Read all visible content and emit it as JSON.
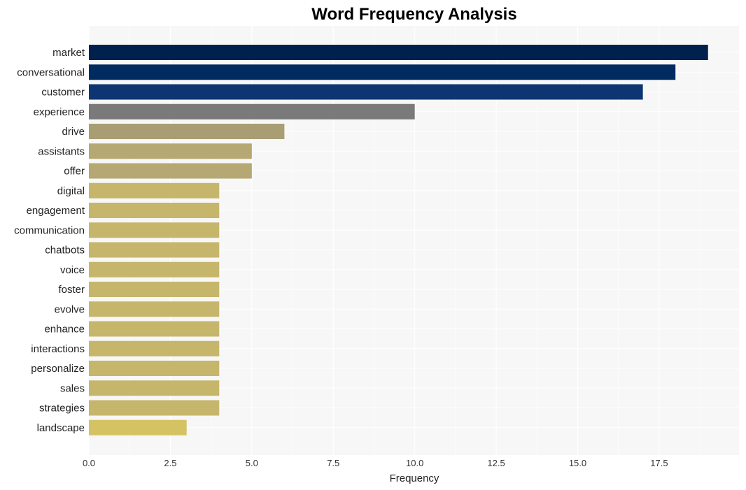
{
  "chart_data": {
    "type": "bar",
    "orientation": "horizontal",
    "title": "Word Frequency Analysis",
    "xlabel": "Frequency",
    "ylabel": "",
    "xlim": [
      0,
      19.95
    ],
    "xticks": [
      0.0,
      2.5,
      5.0,
      7.5,
      10.0,
      12.5,
      15.0,
      17.5
    ],
    "xtick_labels": [
      "0.0",
      "2.5",
      "5.0",
      "7.5",
      "10.0",
      "12.5",
      "15.0",
      "17.5"
    ],
    "grid": true,
    "categories": [
      "market",
      "conversational",
      "customer",
      "experience",
      "drive",
      "assistants",
      "offer",
      "digital",
      "engagement",
      "communication",
      "chatbots",
      "voice",
      "foster",
      "evolve",
      "enhance",
      "interactions",
      "personalize",
      "sales",
      "strategies",
      "landscape"
    ],
    "values": [
      19,
      18,
      17,
      10,
      6,
      5,
      5,
      4,
      4,
      4,
      4,
      4,
      4,
      4,
      4,
      4,
      4,
      4,
      4,
      3
    ],
    "colors": [
      "#00214d",
      "#002b61",
      "#0d3572",
      "#7a7a7a",
      "#a99e73",
      "#b5a872",
      "#b5a872",
      "#c6b66b",
      "#c6b66b",
      "#c6b66b",
      "#c6b66b",
      "#c6b66b",
      "#c6b66b",
      "#c6b66b",
      "#c6b66b",
      "#c6b66b",
      "#c6b66b",
      "#c6b66b",
      "#c6b66b",
      "#d5c263"
    ]
  }
}
